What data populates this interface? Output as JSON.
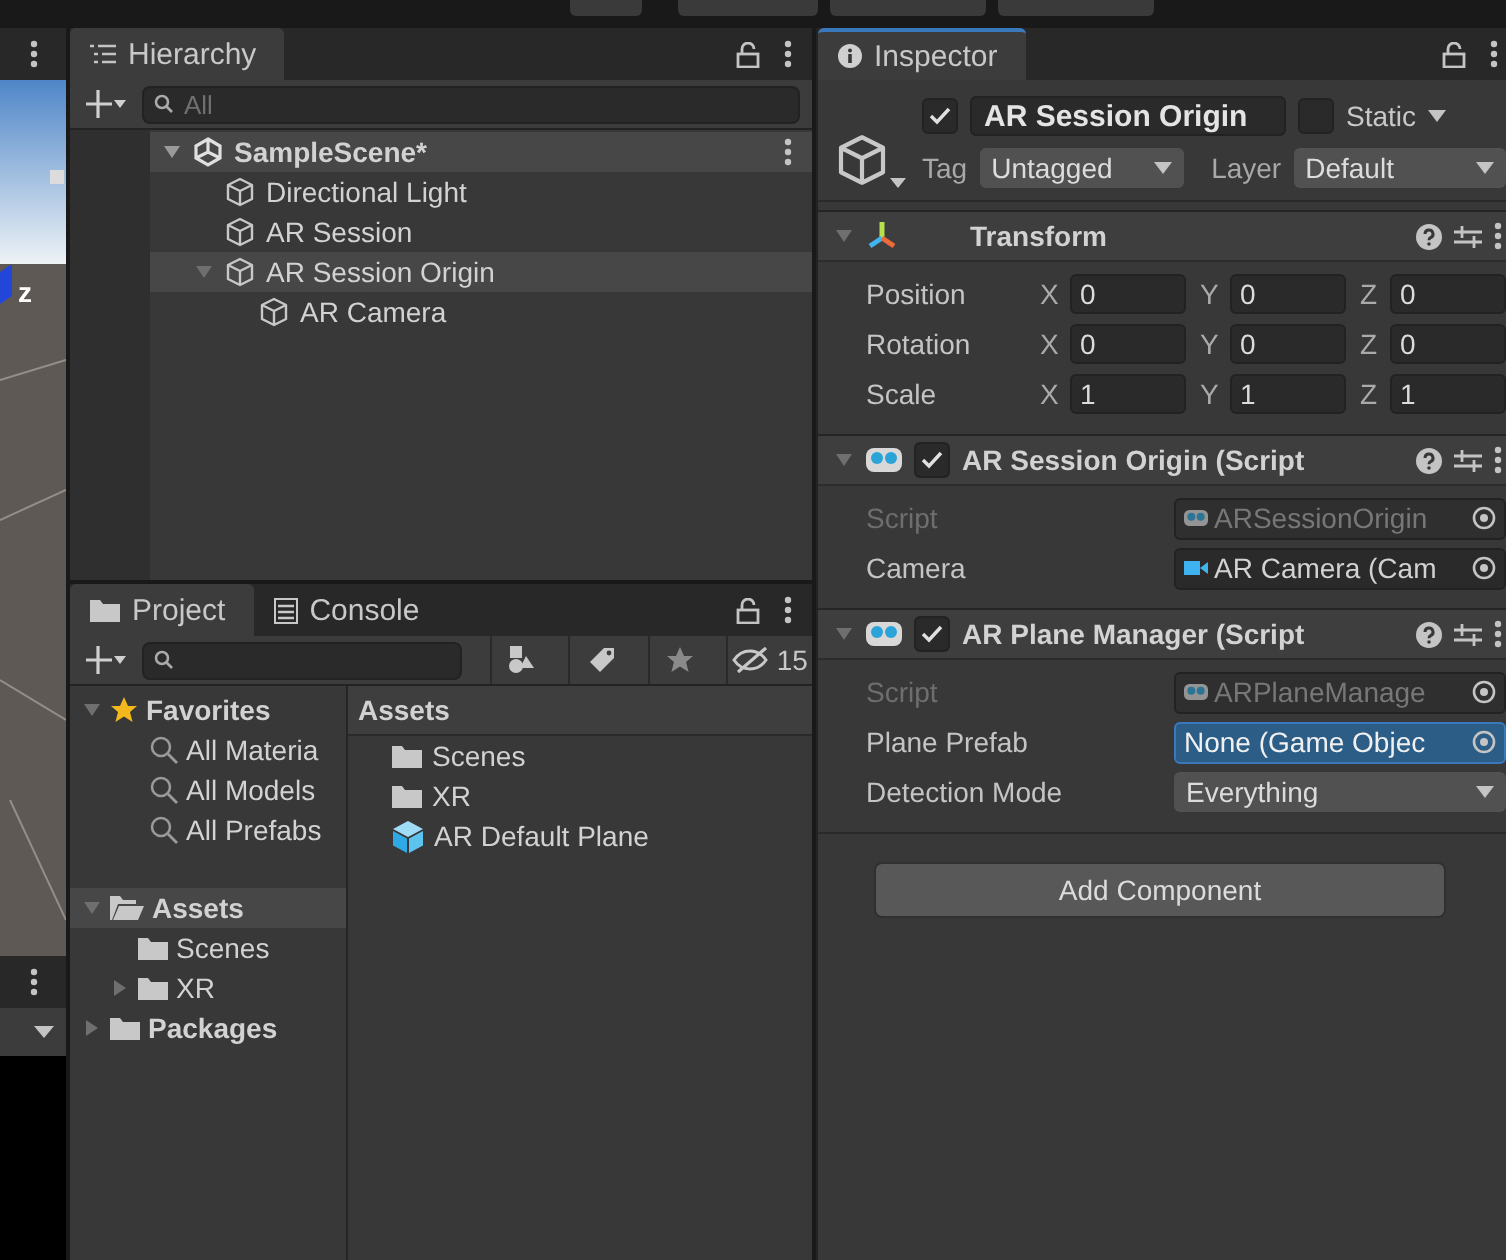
{
  "scene_view": {
    "axis_label": "z"
  },
  "hierarchy": {
    "tab": "Hierarchy",
    "search_placeholder": "All",
    "scene": {
      "name": "SampleScene*",
      "expanded": true
    },
    "items": [
      {
        "name": "Directional Light",
        "selected": false
      },
      {
        "name": "AR Session",
        "selected": false
      },
      {
        "name": "AR Session Origin",
        "selected": true,
        "expanded": true,
        "children": [
          {
            "name": "AR Camera",
            "selected": false
          }
        ]
      }
    ]
  },
  "project": {
    "tabs": [
      {
        "label": "Project",
        "kind": "folder",
        "selected": true
      },
      {
        "label": "Console",
        "kind": "console",
        "selected": false
      }
    ],
    "hidden_count": "15",
    "favorites": {
      "label": "Favorites",
      "expanded": true,
      "items": [
        "All Materia",
        "All Models",
        "All Prefabs"
      ]
    },
    "tree": [
      {
        "name": "Assets",
        "selected": true,
        "expanded": true,
        "children": [
          {
            "name": "Scenes",
            "selected": false
          },
          {
            "name": "XR",
            "selected": false,
            "expanded": false
          }
        ]
      },
      {
        "name": "Packages",
        "selected": false,
        "expanded": false
      }
    ],
    "breadcrumb": "Assets",
    "assets": [
      {
        "name": "Scenes",
        "kind": "folder"
      },
      {
        "name": "XR",
        "kind": "folder"
      },
      {
        "name": "AR Default Plane",
        "kind": "prefab"
      }
    ]
  },
  "inspector": {
    "tab": "Inspector",
    "object": {
      "active": true,
      "name": "AR Session Origin",
      "static": false,
      "static_label": "Static",
      "tag_label": "Tag",
      "tag": "Untagged",
      "layer_label": "Layer",
      "layer": "Default"
    },
    "components": [
      {
        "kind": "transform",
        "title": "Transform",
        "expanded": true,
        "rows": [
          {
            "label": "Position",
            "fields": [
              {
                "axis": "X",
                "value": "0"
              },
              {
                "axis": "Y",
                "value": "0"
              },
              {
                "axis": "Z",
                "value": "0"
              }
            ]
          },
          {
            "label": "Rotation",
            "fields": [
              {
                "axis": "X",
                "value": "0"
              },
              {
                "axis": "Y",
                "value": "0"
              },
              {
                "axis": "Z",
                "value": "0"
              }
            ]
          },
          {
            "label": "Scale",
            "fields": [
              {
                "axis": "X",
                "value": "1"
              },
              {
                "axis": "Y",
                "value": "1"
              },
              {
                "axis": "Z",
                "value": "1"
              }
            ]
          }
        ]
      },
      {
        "kind": "script",
        "title": "AR Session Origin (Script",
        "enabled": true,
        "expanded": true,
        "fields": [
          {
            "label": "Script",
            "value": "ARSessionOrigin",
            "kind": "script",
            "disabled": true
          },
          {
            "label": "Camera",
            "value": "AR Camera (Cam",
            "kind": "camera",
            "disabled": false,
            "selected": false
          }
        ]
      },
      {
        "kind": "script",
        "title": "AR Plane Manager (Script",
        "enabled": true,
        "expanded": true,
        "fields": [
          {
            "label": "Script",
            "value": "ARPlaneManage",
            "kind": "script",
            "disabled": true
          },
          {
            "label": "Plane Prefab",
            "value": "None (Game Objec",
            "kind": "object",
            "disabled": false,
            "selected": true
          },
          {
            "label": "Detection Mode",
            "value": "Everything",
            "kind": "dropdown",
            "disabled": false
          }
        ]
      }
    ],
    "add_component": "Add Component"
  }
}
